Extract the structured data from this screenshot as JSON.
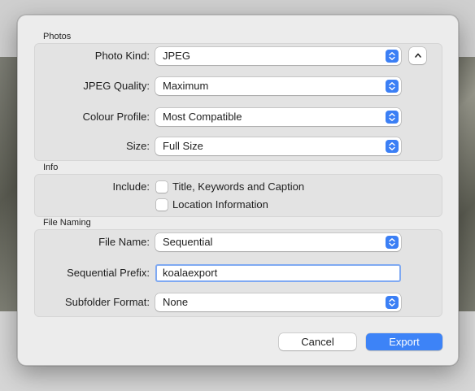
{
  "sections": {
    "photos": "Photos",
    "info": "Info",
    "file_naming": "File Naming"
  },
  "photos": {
    "photo_kind": {
      "label": "Photo Kind:",
      "value": "JPEG"
    },
    "jpeg_quality": {
      "label": "JPEG Quality:",
      "value": "Maximum"
    },
    "colour_profile": {
      "label": "Colour Profile:",
      "value": "Most Compatible"
    },
    "size": {
      "label": "Size:",
      "value": "Full Size"
    }
  },
  "info": {
    "include_label": "Include:",
    "options": [
      {
        "label": "Title, Keywords and Caption",
        "checked": false
      },
      {
        "label": "Location Information",
        "checked": false
      }
    ]
  },
  "file_naming": {
    "file_name": {
      "label": "File Name:",
      "value": "Sequential"
    },
    "sequential_prefix": {
      "label": "Sequential Prefix:",
      "value": "koalaexport"
    },
    "subfolder_format": {
      "label": "Subfolder Format:",
      "value": "None"
    }
  },
  "buttons": {
    "cancel": "Cancel",
    "export": "Export"
  },
  "colors": {
    "accent": "#3d83f7",
    "sheet_background": "#ececec",
    "group_background": "#e3e3e3"
  },
  "icons": {
    "popup": "up-down-chevron-icon",
    "disclosure": "chevron-up-icon"
  }
}
